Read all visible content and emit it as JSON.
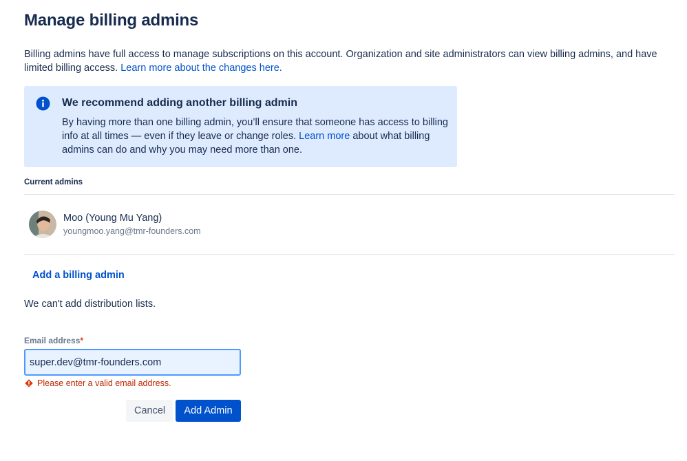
{
  "page": {
    "title": "Manage billing admins",
    "intro_text": "Billing admins have full access to manage subscriptions on this account. Organization and site administrators can view billing admins, and have limited billing access. ",
    "intro_link": "Learn more about the changes here."
  },
  "notice": {
    "title": "We recommend adding another billing admin",
    "body_before": "By having more than one billing admin, you’ll ensure that someone has access to billing info at all times — even if they leave or change roles. ",
    "body_link": "Learn more",
    "body_after": " about what billing admins can do and why you may need more than one.",
    "icon": "info-icon",
    "background": "#deebff"
  },
  "admins": {
    "section_label": "Current admins",
    "list": [
      {
        "name": "Moo (Young Mu Yang)",
        "email": "youngmoo.yang@tmr-founders.com"
      }
    ]
  },
  "add_form": {
    "add_link": "Add a billing admin",
    "distribution_note": "We can't add distribution lists.",
    "email_label": "Email address",
    "required_marker": "*",
    "email_value": "super.dev@tmr-founders.com",
    "error_message": "Please enter a valid email address.",
    "cancel_label": "Cancel",
    "submit_label": "Add Admin"
  },
  "colors": {
    "primary": "#0052cc",
    "text": "#172b4d",
    "error": "#bf2600",
    "input_focus_border": "#4c9aff"
  }
}
